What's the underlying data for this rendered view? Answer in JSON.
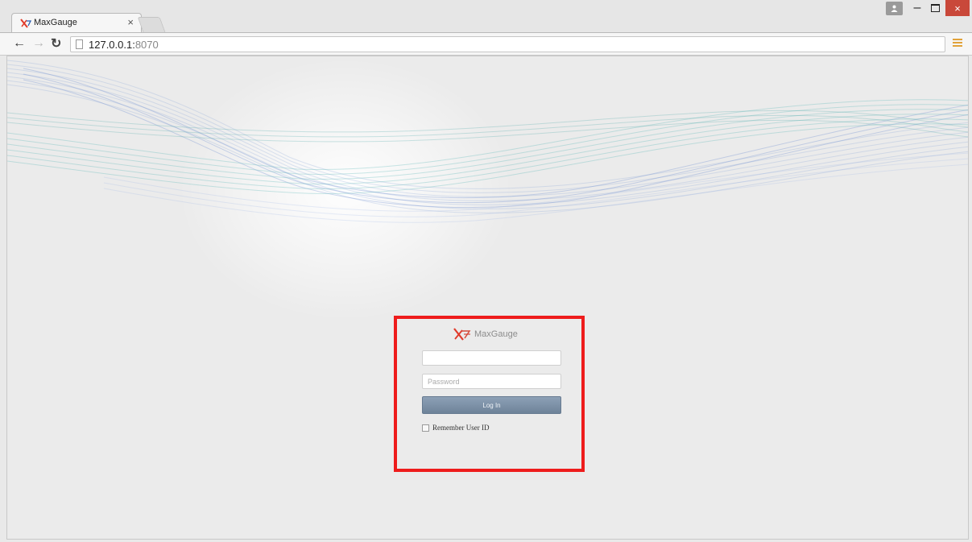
{
  "browser": {
    "tab_title": "MaxGauge",
    "tab_close": "×",
    "url_host": "127.0.0.1:",
    "url_port": "8070",
    "close_symbol": "×",
    "minimize_symbol": "–"
  },
  "login": {
    "brand": "MaxGauge",
    "userid_placeholder": "",
    "password_placeholder": "Password",
    "login_label": "Log In",
    "remember_label": "Remember User ID",
    "highlight_color": "#ee1c1c",
    "button_color": "#7a8ea4"
  }
}
